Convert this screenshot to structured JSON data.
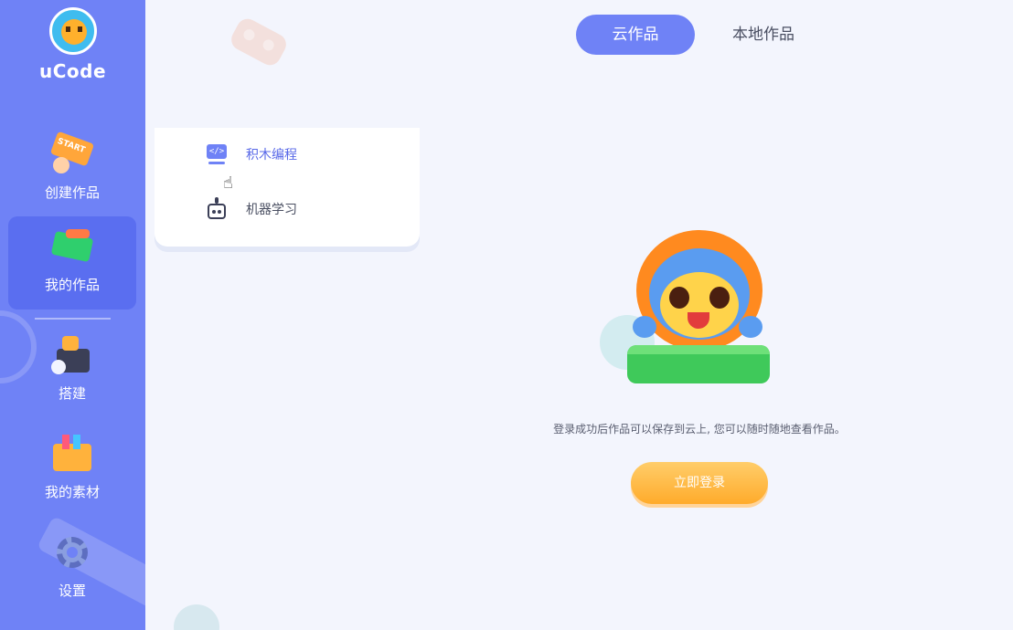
{
  "app": {
    "logo_text": "uCode"
  },
  "sidebar": {
    "items": [
      {
        "label": "创建作品",
        "icon": "start-sign-icon"
      },
      {
        "label": "我的作品",
        "icon": "works-folder-icon",
        "active": true
      },
      {
        "label": "搭建",
        "icon": "build-blocks-icon"
      },
      {
        "label": "我的素材",
        "icon": "asset-folder-icon"
      },
      {
        "label": "设置",
        "icon": "gear-icon"
      }
    ]
  },
  "tabs": [
    {
      "label": "云作品",
      "active": true
    },
    {
      "label": "本地作品",
      "active": false
    }
  ],
  "dropdown": {
    "items": [
      {
        "label": "积木编程",
        "icon": "code-screen-icon"
      },
      {
        "label": "机器学习",
        "icon": "robot-icon"
      }
    ]
  },
  "empty_state": {
    "message": "登录成功后作品可以保存到云上, 您可以随时随地查看作品。",
    "login_button": "立即登录"
  },
  "colors": {
    "sidebar_bg": "#6f82f6",
    "active_item_bg": "#5a6ef0",
    "accent": "#6f82f6",
    "login_button": "#ffab2b",
    "page_bg": "#f3f5fd"
  }
}
